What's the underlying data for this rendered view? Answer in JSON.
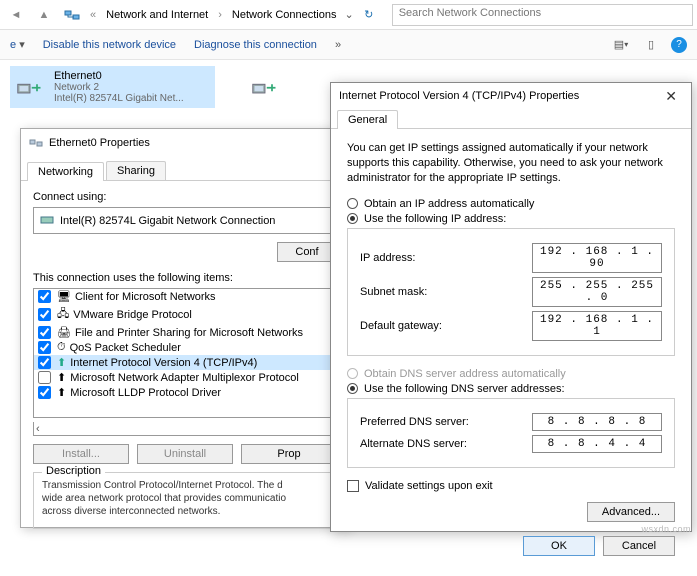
{
  "breadcrumb": {
    "p1": "Network and Internet",
    "p2": "Network Connections"
  },
  "search_placeholder": "Search Network Connections",
  "cmdbar": {
    "organize": "e",
    "disable": "Disable this network device",
    "diagnose": "Diagnose this connection"
  },
  "connections": [
    {
      "name": "Ethernet0",
      "net": "Network 2",
      "adapter": "Intel(R) 82574L Gigabit Net..."
    },
    {
      "name": "",
      "net": "",
      "adapter": ""
    }
  ],
  "dlg1": {
    "title": "Ethernet0 Properties",
    "tabs": {
      "networking": "Networking",
      "sharing": "Sharing"
    },
    "connect_using": "Connect using:",
    "adapter": "Intel(R) 82574L Gigabit Network Connection",
    "configure": "Conf",
    "items_label": "This connection uses the following items:",
    "items": [
      {
        "checked": true,
        "label": "Client for Microsoft Networks"
      },
      {
        "checked": true,
        "label": "VMware Bridge Protocol"
      },
      {
        "checked": true,
        "label": "File and Printer Sharing for Microsoft Networks"
      },
      {
        "checked": true,
        "label": "QoS Packet Scheduler"
      },
      {
        "checked": true,
        "label": "Internet Protocol Version 4 (TCP/IPv4)"
      },
      {
        "checked": false,
        "label": "Microsoft Network Adapter Multiplexor Protocol"
      },
      {
        "checked": true,
        "label": "Microsoft LLDP Protocol Driver"
      }
    ],
    "install": "Install...",
    "uninstall": "Uninstall",
    "properties": "Prop",
    "description_label": "Description",
    "description": "Transmission Control Protocol/Internet Protocol. The d\nwide area network protocol that provides communicatio\nacross diverse interconnected networks."
  },
  "dlg2": {
    "title": "Internet Protocol Version 4 (TCP/IPv4) Properties",
    "tab_general": "General",
    "intro": "You can get IP settings assigned automatically if your network supports this capability. Otherwise, you need to ask your network administrator for the appropriate IP settings.",
    "ip_auto": "Obtain an IP address automatically",
    "ip_manual": "Use the following IP address:",
    "ip_address_label": "IP address:",
    "ip_address": "192 . 168 .  1  . 90",
    "subnet_label": "Subnet mask:",
    "subnet": "255 . 255 . 255 .  0",
    "gateway_label": "Default gateway:",
    "gateway": "192 . 168 .  1  .  1",
    "dns_auto": "Obtain DNS server address automatically",
    "dns_manual": "Use the following DNS server addresses:",
    "pref_dns_label": "Preferred DNS server:",
    "pref_dns": "8  .  8  .  8  .  8",
    "alt_dns_label": "Alternate DNS server:",
    "alt_dns": "8  .  8  .  4  .  4",
    "validate": "Validate settings upon exit",
    "advanced": "Advanced...",
    "ok": "OK",
    "cancel": "Cancel"
  },
  "watermark": "wsxdn.com"
}
